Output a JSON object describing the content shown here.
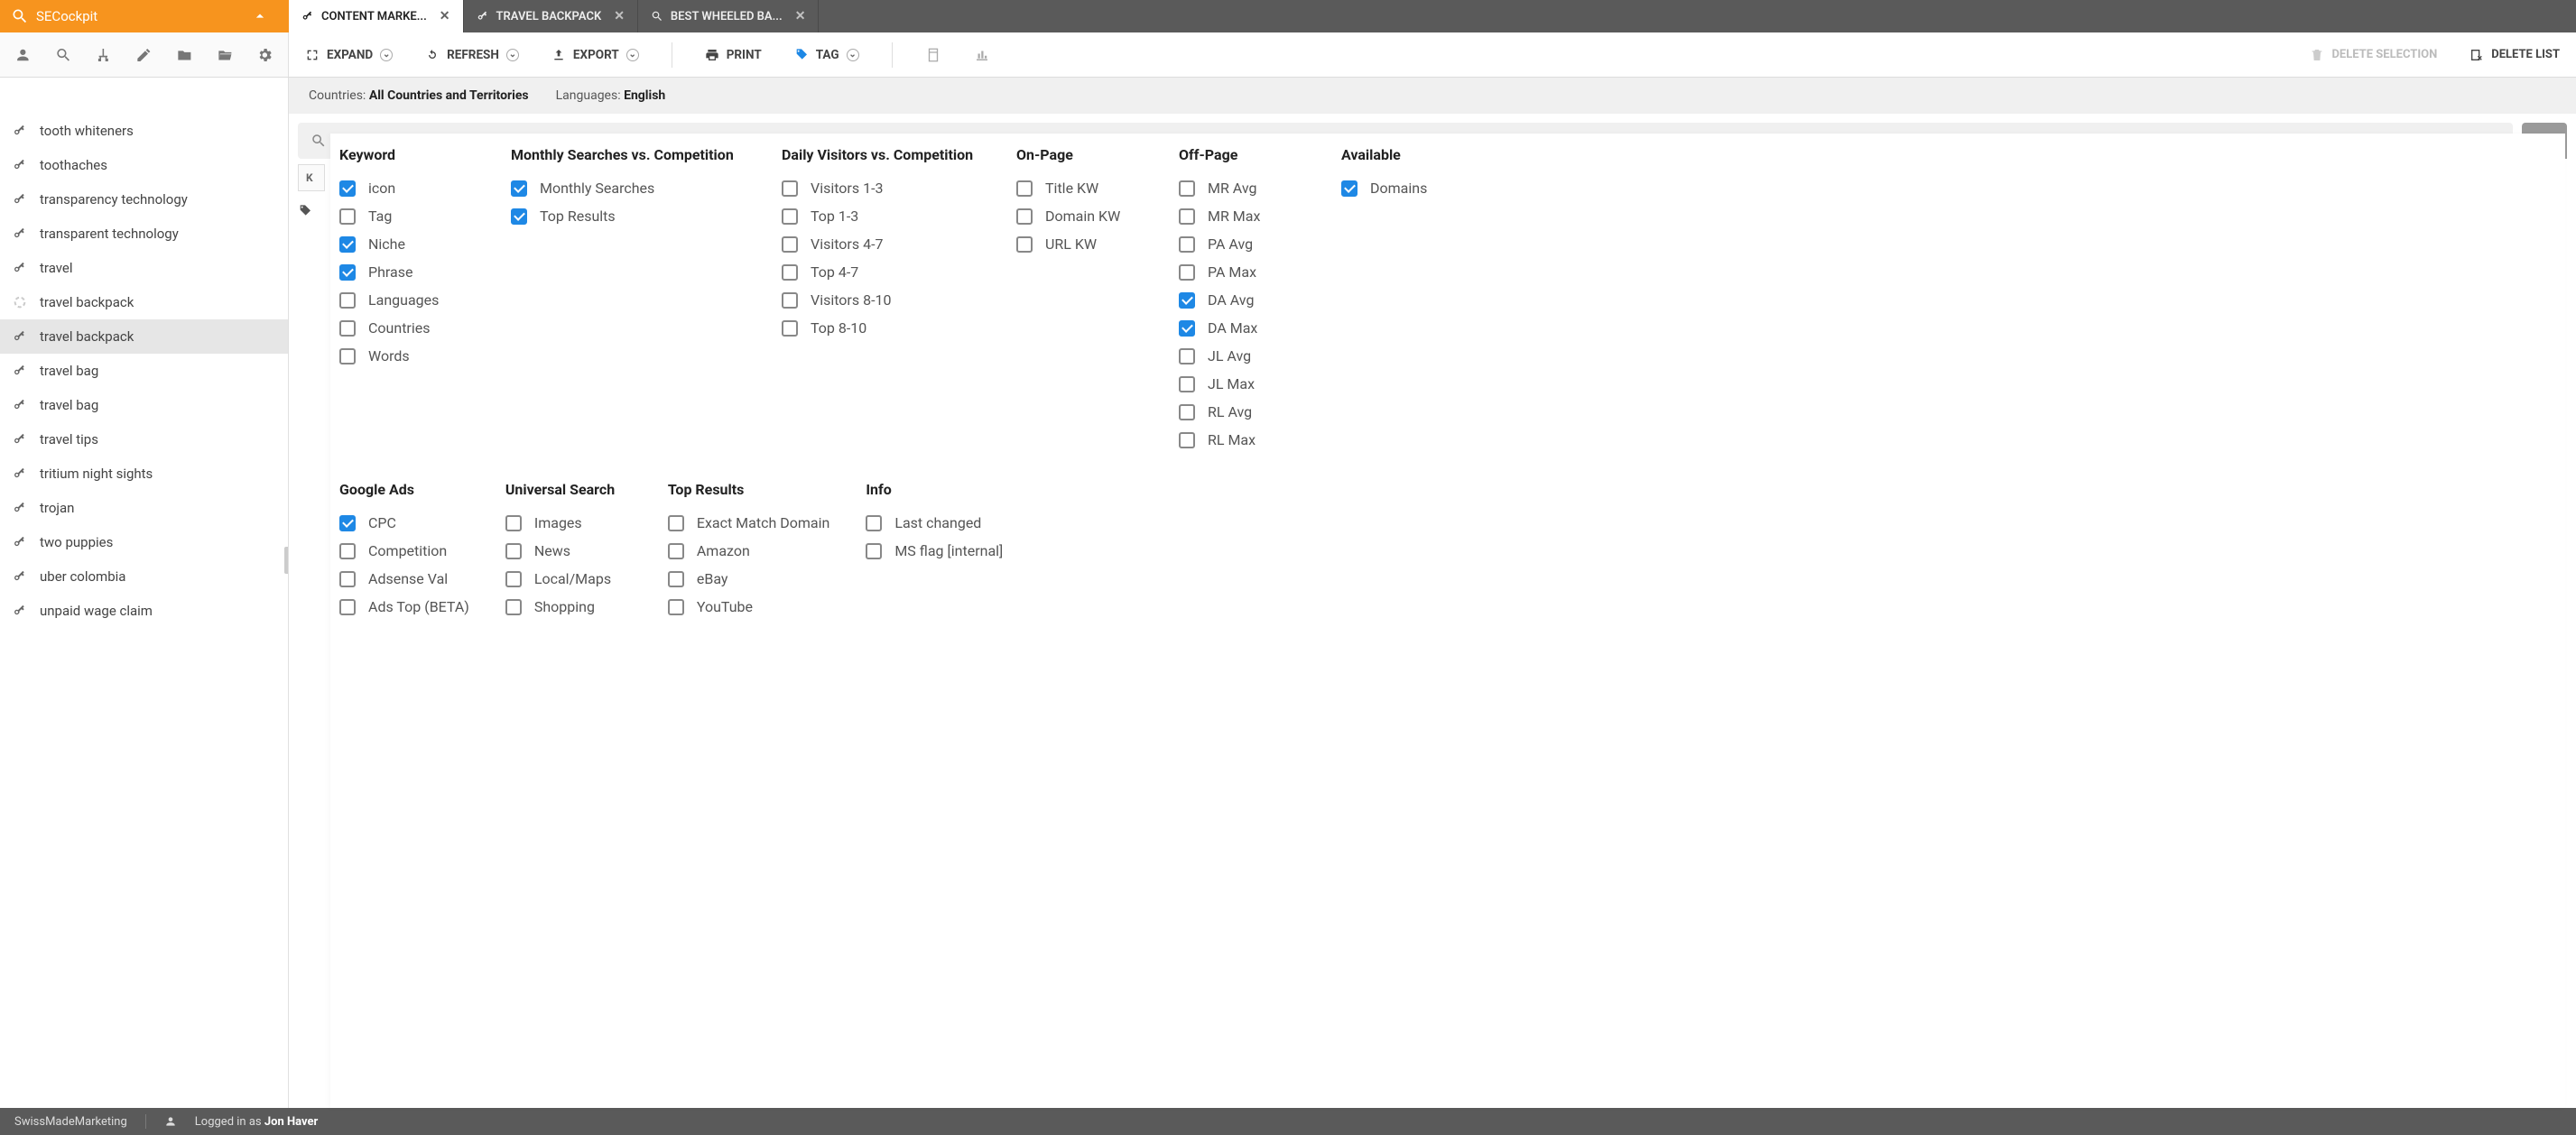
{
  "brand": {
    "name": "SECockpit"
  },
  "tabs": [
    {
      "label": "CONTENT MARKE...",
      "icon": "key",
      "active": true
    },
    {
      "label": "TRAVEL BACKPACK",
      "icon": "key",
      "active": false
    },
    {
      "label": "BEST WHEELED BA...",
      "icon": "search",
      "active": false
    }
  ],
  "toolbar": {
    "expand": "EXPAND",
    "refresh": "REFRESH",
    "export": "EXPORT",
    "print": "PRINT",
    "tag": "TAG",
    "delete_selection": "DELETE SELECTION",
    "delete_list": "DELETE LIST"
  },
  "filters": {
    "countries_label": "Countries:",
    "countries_value": "All Countries and Territories",
    "languages_label": "Languages:",
    "languages_value": "English"
  },
  "sidebar": [
    {
      "label": "tooth whiteners",
      "active": false,
      "icon": "key"
    },
    {
      "label": "toothaches",
      "active": false,
      "icon": "key"
    },
    {
      "label": "transparency technology",
      "active": false,
      "icon": "key"
    },
    {
      "label": "transparent technology",
      "active": false,
      "icon": "key"
    },
    {
      "label": "travel",
      "active": false,
      "icon": "key"
    },
    {
      "label": "travel backpack",
      "active": false,
      "icon": "loading"
    },
    {
      "label": "travel backpack",
      "active": true,
      "icon": "key"
    },
    {
      "label": "travel bag",
      "active": false,
      "icon": "key"
    },
    {
      "label": "travel bag",
      "active": false,
      "icon": "key"
    },
    {
      "label": "travel tips",
      "active": false,
      "icon": "key"
    },
    {
      "label": "tritium night sights",
      "active": false,
      "icon": "key"
    },
    {
      "label": "trojan",
      "active": false,
      "icon": "key"
    },
    {
      "label": "two puppies",
      "active": false,
      "icon": "key"
    },
    {
      "label": "uber colombia",
      "active": false,
      "icon": "key"
    },
    {
      "label": "unpaid wage claim",
      "active": false,
      "icon": "key"
    }
  ],
  "table": {
    "col0": "K"
  },
  "panel": {
    "row1": [
      {
        "title": "Keyword",
        "cls": "w-keyword",
        "items": [
          {
            "label": "icon",
            "checked": true
          },
          {
            "label": "Tag",
            "checked": false
          },
          {
            "label": "Niche",
            "checked": true
          },
          {
            "label": "Phrase",
            "checked": true
          },
          {
            "label": "Languages",
            "checked": false
          },
          {
            "label": "Countries",
            "checked": false
          },
          {
            "label": "Words",
            "checked": false
          }
        ]
      },
      {
        "title": "Monthly Searches vs. Competition",
        "cls": "w-monthly",
        "items": [
          {
            "label": "Monthly Searches",
            "checked": true
          },
          {
            "label": "Top Results",
            "checked": true
          }
        ]
      },
      {
        "title": "Daily Visitors vs. Competition",
        "cls": "w-daily",
        "items": [
          {
            "label": "Visitors 1-3",
            "checked": false
          },
          {
            "label": "Top 1-3",
            "checked": false
          },
          {
            "label": "Visitors 4-7",
            "checked": false
          },
          {
            "label": "Top 4-7",
            "checked": false
          },
          {
            "label": "Visitors 8-10",
            "checked": false
          },
          {
            "label": "Top 8-10",
            "checked": false
          }
        ]
      },
      {
        "title": "On-Page",
        "cls": "w-onpage",
        "items": [
          {
            "label": "Title KW",
            "checked": false
          },
          {
            "label": "Domain KW",
            "checked": false
          },
          {
            "label": "URL KW",
            "checked": false
          }
        ]
      },
      {
        "title": "Off-Page",
        "cls": "w-offpage",
        "items": [
          {
            "label": "MR Avg",
            "checked": false
          },
          {
            "label": "MR Max",
            "checked": false
          },
          {
            "label": "PA Avg",
            "checked": false
          },
          {
            "label": "PA Max",
            "checked": false
          },
          {
            "label": "DA Avg",
            "checked": true
          },
          {
            "label": "DA Max",
            "checked": true
          },
          {
            "label": "JL Avg",
            "checked": false
          },
          {
            "label": "JL Max",
            "checked": false
          },
          {
            "label": "RL Avg",
            "checked": false
          },
          {
            "label": "RL Max",
            "checked": false
          }
        ]
      },
      {
        "title": "Available",
        "cls": "",
        "items": [
          {
            "label": "Domains",
            "checked": true
          }
        ]
      }
    ],
    "row2": [
      {
        "title": "Google Ads",
        "items": [
          {
            "label": "CPC",
            "checked": true
          },
          {
            "label": "Competition",
            "checked": false
          },
          {
            "label": "Adsense Val",
            "checked": false
          },
          {
            "label": "Ads Top (BETA)",
            "checked": false
          }
        ]
      },
      {
        "title": "Universal Search",
        "items": [
          {
            "label": "Images",
            "checked": false
          },
          {
            "label": "News",
            "checked": false
          },
          {
            "label": "Local/Maps",
            "checked": false
          },
          {
            "label": "Shopping",
            "checked": false
          }
        ]
      },
      {
        "title": "Top Results",
        "items": [
          {
            "label": "Exact Match Domain",
            "checked": false
          },
          {
            "label": "Amazon",
            "checked": false
          },
          {
            "label": "eBay",
            "checked": false
          },
          {
            "label": "YouTube",
            "checked": false
          }
        ]
      },
      {
        "title": "Info",
        "items": [
          {
            "label": "Last changed",
            "checked": false
          },
          {
            "label": "MS flag [internal]",
            "checked": false
          }
        ]
      }
    ]
  },
  "footer": {
    "company": "SwissMadeMarketing",
    "login_prefix": "Logged in as ",
    "user": "Jon Haver"
  }
}
